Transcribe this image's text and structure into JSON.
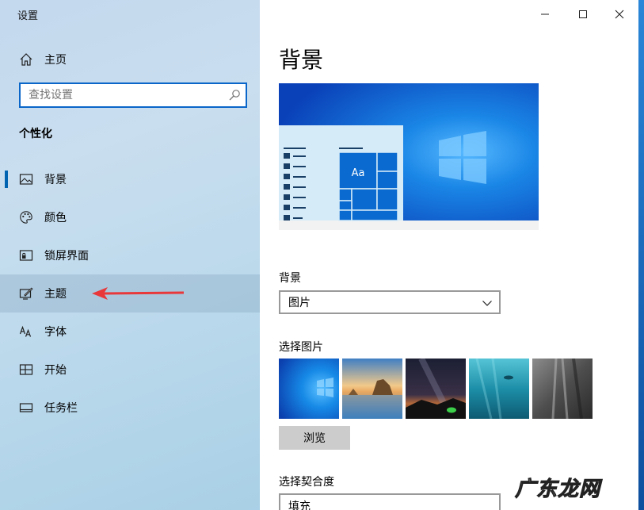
{
  "window": {
    "title": "设置"
  },
  "sidebar": {
    "home_label": "主页",
    "search_placeholder": "查找设置",
    "section_title": "个性化",
    "items": [
      {
        "label": "背景",
        "icon": "picture-icon"
      },
      {
        "label": "颜色",
        "icon": "palette-icon"
      },
      {
        "label": "锁屏界面",
        "icon": "lock-screen-icon"
      },
      {
        "label": "主题",
        "icon": "theme-brush-icon"
      },
      {
        "label": "字体",
        "icon": "font-icon"
      },
      {
        "label": "开始",
        "icon": "start-menu-icon"
      },
      {
        "label": "任务栏",
        "icon": "taskbar-icon"
      }
    ],
    "active_item": "背景",
    "hover_item": "主题"
  },
  "main": {
    "page_title": "背景",
    "preview": {
      "sample_text": "Aa"
    },
    "background_label": "背景",
    "background_value": "图片",
    "choose_picture_label": "选择图片",
    "browse_label": "浏览",
    "fit_label": "选择契合度",
    "fit_value": "填充"
  },
  "watermark": "广东龙网",
  "colors": {
    "accent": "#0063b1",
    "search_border": "#0a66c8",
    "arrow": "#e8383a"
  }
}
